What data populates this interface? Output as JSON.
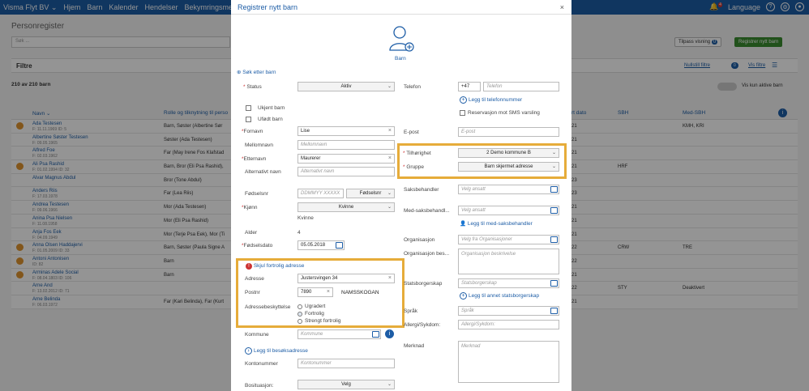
{
  "topnav": {
    "brand": "Visma Flyt BV ⌄",
    "items": [
      "Hjem",
      "Barn",
      "Kalender",
      "Hendelser",
      "Bekymringsmeld"
    ],
    "language": "Language",
    "notif_count": "4"
  },
  "background": {
    "page_title": "Personregister",
    "search_placeholder": "Søk ...",
    "tilpass_label": "Tilpass visning",
    "tilpass_count": "0",
    "register_label": "Registrer nytt barn",
    "filters_label": "Filtre",
    "reset_filters": "Nullstill filtre",
    "reset_count": "0",
    "show_filters": "Vis filtre",
    "count_label": "210 av 210 barn",
    "only_active": "Vis kun aktive barn",
    "col_name": "Navn ⌄",
    "col_role": "Rolle og tilknytning til perso",
    "col_start": "rt dato",
    "col_sbh": "SBH",
    "col_medsbh": "Med-SBH",
    "rows": [
      {
        "name": "Ada Testesen",
        "sub": "F: 11.11.1969  ID: 5",
        "role": "Barn, Søster (Albertine Sør",
        "date": "21",
        "c1": "",
        "c2": "KMH, KRI",
        "avatar": true
      },
      {
        "name": "Albertine Søster Testesen",
        "sub": "F: 09.05.1965",
        "role": "Søster (Ada Testesen)",
        "date": "21",
        "c1": "",
        "c2": "",
        "avatar": false
      },
      {
        "name": "Alfred Foe",
        "sub": "F: 02.03.1962",
        "role": "Far (May Irene Fos Klafstad",
        "date": "21",
        "c1": "",
        "c2": "",
        "avatar": false
      },
      {
        "name": "Ali Psa Rashid",
        "sub": "F: 01.02.1994  ID: 32",
        "role": "Barn, Bror (Eli Psa Rashid),",
        "date": "21",
        "c1": "HRF",
        "c2": "",
        "avatar": true
      },
      {
        "name": "Alvar Magnus Abdul",
        "sub": "",
        "role": "Bror (Tone Abdul)",
        "date": "23",
        "c1": "",
        "c2": "",
        "avatar": false
      },
      {
        "name": "Anders Riis",
        "sub": "F: 17.03.1978",
        "role": "Far (Lea Riis)",
        "date": "23",
        "c1": "",
        "c2": "",
        "avatar": false
      },
      {
        "name": "Andrea Testesen",
        "sub": "F: 09.06.1966",
        "role": "Mor (Ada Testesen)",
        "date": "21",
        "c1": "",
        "c2": "",
        "avatar": false
      },
      {
        "name": "Anina Psa Nielsen",
        "sub": "F: 11.08.1958",
        "role": "Mor (Eli Psa Rashid)",
        "date": "21",
        "c1": "",
        "c2": "",
        "avatar": false
      },
      {
        "name": "Anja Fos Eek",
        "sub": "F: 04.09.1949",
        "role": "Mor (Terje Psa Eek), Mor (Ti",
        "date": "21",
        "c1": "",
        "c2": "",
        "avatar": false
      },
      {
        "name": "Anna Olsen Haddajervi",
        "sub": "F: 01.05.2009  ID: 33",
        "role": "Barn, Søster (Paula Signe A",
        "date": "22",
        "c1": "CRW",
        "c2": "TRE",
        "avatar": true
      },
      {
        "name": "Antoni Antonisen",
        "sub": "ID: 82",
        "role": "Barn",
        "date": "22",
        "c1": "",
        "c2": "",
        "avatar": true
      },
      {
        "name": "Arminas Adele Social",
        "sub": "F: 08.04.1803  ID: 106",
        "role": "Barn",
        "date": "21",
        "c1": "",
        "c2": "",
        "avatar": true
      },
      {
        "name": "Arne And",
        "sub": "F: 13.02.2012  ID: 71",
        "role": "",
        "date": "22",
        "c1": "STY",
        "c2": "Deaktivert",
        "avatar": false
      },
      {
        "name": "Arne Belinda",
        "sub": "F: 06.03.1972",
        "role": "Far (Kari Belinda), Far (Kurt",
        "date": "21",
        "c1": "",
        "c2": "",
        "avatar": false
      }
    ]
  },
  "modal": {
    "title": "Registrer nytt barn",
    "avatar_label": "Barn",
    "search_child": "Søk etter barn",
    "status_label": "Status",
    "status_value": "Aktiv",
    "unknown_child": "Ukjent barn",
    "unborn_child": "Ufødt barn",
    "firstname_label": "Fornavn",
    "firstname_value": "Lise",
    "middlename_label": "Mellomnavn",
    "middlename_ph": "Mellomnavn",
    "lastname_label": "Etternavn",
    "lastname_value": "Maurerer",
    "altname_label": "Alternativt navn",
    "altname_ph": "Alternativt navn",
    "ssn_label": "Fødselsnr",
    "ssn_ph": "DDMMYY XXXXX",
    "ssn_type": "Fødselsnr",
    "gender_label": "Kjønn",
    "gender_value": "Kvinne",
    "gender_text": "Kvinne",
    "age_label": "Alder",
    "age_value": "4",
    "dob_label": "Fødselsdato",
    "dob_value": "05.05.2018",
    "hide_address": "Skjul fortrolig adresse",
    "address_label": "Adresse",
    "address_value": "Justersvingen 34",
    "postal_label": "Postnr",
    "postal_value": "7890",
    "city_value": "NAMSSKOGAN",
    "protection_label": "Adressebeskyttelse",
    "protection_options": [
      "Ugradert",
      "Fortrolig",
      "Strengt fortrolig"
    ],
    "protection_selected": "Fortrolig",
    "kommune_label": "Kommune",
    "kommune_ph": "Kommune",
    "visit_address": "Legg til besøksadresse",
    "account_label": "Kontonummer",
    "account_ph": "Kontonummer",
    "housing_label": "Bosituasjon:",
    "housing_value": "Velg",
    "phone_label": "Telefon",
    "phone_prefix": "+47",
    "phone_ph": "Telefon",
    "add_phone": "Legg til telefonnummer",
    "sms_reservation": "Reservasjon mot SMS varsling",
    "email_label": "E-post",
    "email_ph": "E-post",
    "belonging_label": "Tilhørighet",
    "belonging_value": "2 Demo kommune B",
    "group_label": "Gruppe",
    "group_value": "Barn skjermet adresse",
    "case_worker_label": "Saksbehandler",
    "case_worker_ph": "Velg ansatt",
    "co_worker_label": "Med-saksbehandl...",
    "co_worker_ph": "Velg ansatt",
    "add_co_worker": "Legg til med-saksbehandler",
    "org_label": "Organisasjon",
    "org_ph": "Velg fra Organisasjoner",
    "org_desc_label": "Organisasjon bes...",
    "org_desc_ph": "Organisasjon beskrivelse",
    "citizenship_label": "Statsborgerskap",
    "citizenship_ph": "Statsborgerskap",
    "add_citizenship": "Legg til annet statsborgerskap",
    "language_label": "Språk",
    "language_ph": "Språk",
    "allergy_label": "Allergi/Sykdom:",
    "allergy_ph": "Allergi/Sykdom:",
    "note_label": "Merknad",
    "note_ph": "Merknad",
    "colors": {
      "link": "#1d5da6",
      "highlight": "#e6ac3a",
      "required": "#cc3333",
      "primary_green": "#3a8c2f"
    }
  }
}
